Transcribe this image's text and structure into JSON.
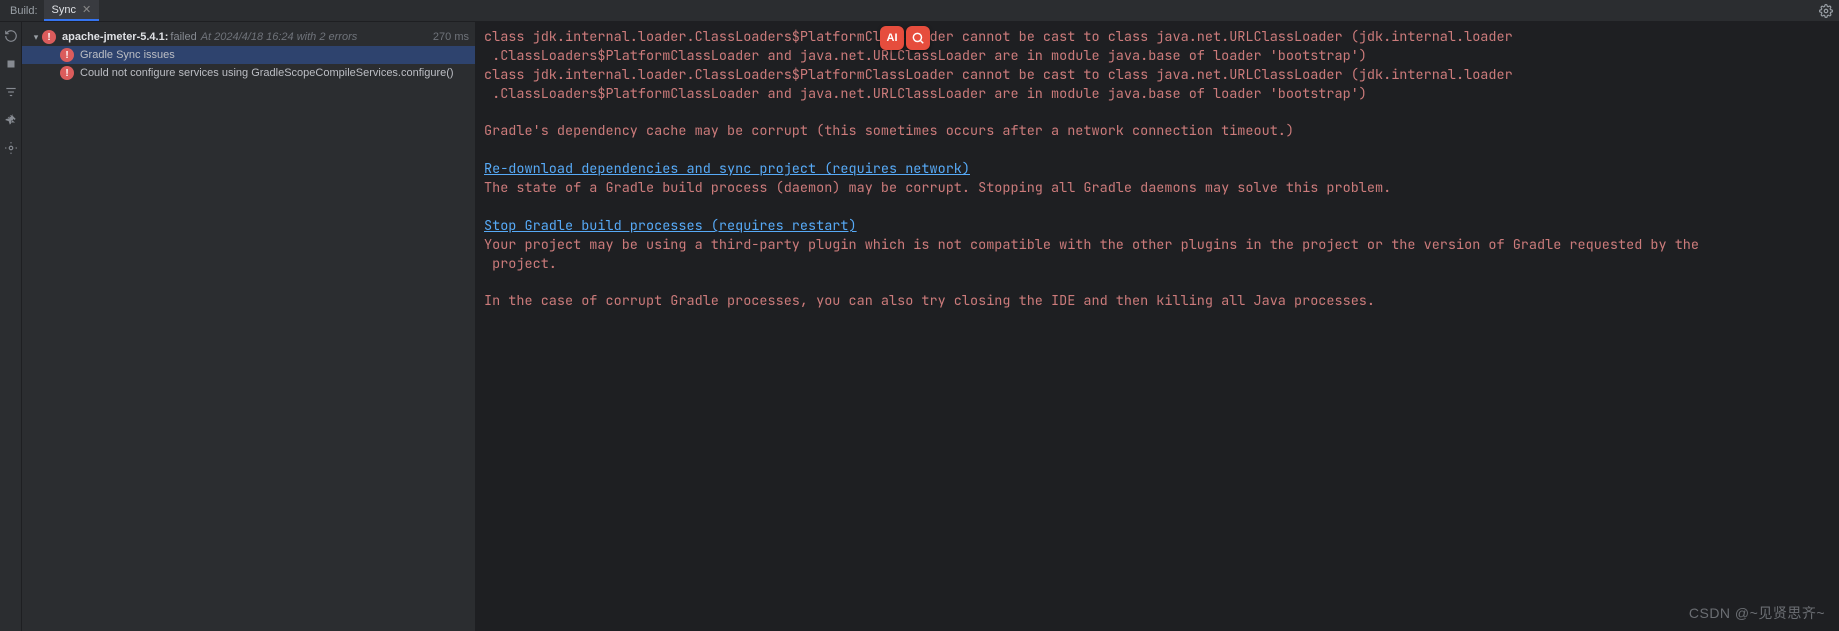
{
  "tabs": {
    "prefix": "Build:",
    "active": "Sync"
  },
  "tree": {
    "root": {
      "name": "apache-jmeter-5.4.1:",
      "status": "failed",
      "timestamp": "At 2024/4/18 16:24 with 2 errors",
      "duration": "270 ms"
    },
    "issues": [
      "Gradle Sync issues",
      "Could not configure services using GradleScopeCompileServices.configure()"
    ]
  },
  "console": {
    "err1a": "class jdk.internal.loader.ClassLoaders$PlatformClassLoader cannot be cast to class java.net.URLClassLoader (jdk.internal.loader",
    "err1b": " .ClassLoaders$PlatformClassLoader and java.net.URLClassLoader are in module java.base of loader 'bootstrap')",
    "err2a": "class jdk.internal.loader.ClassLoaders$PlatformClassLoader cannot be cast to class java.net.URLClassLoader (jdk.internal.loader",
    "err2b": " .ClassLoaders$PlatformClassLoader and java.net.URLClassLoader are in module java.base of loader 'bootstrap')",
    "cache_msg": "Gradle's dependency cache may be corrupt (this sometimes occurs after a network connection timeout.)",
    "link1": "Re-download dependencies and sync project (requires network)",
    "daemon_msg": "The state of a Gradle build process (daemon) may be corrupt. Stopping all Gradle daemons may solve this problem.",
    "link2": "Stop Gradle build processes (requires restart)",
    "plugin_msg": "Your project may be using a third-party plugin which is not compatible with the other plugins in the project or the version of Gradle requested by the\n project.",
    "close_msg": "In the case of corrupt Gradle processes, you can also try closing the IDE and then killing all Java processes."
  },
  "overlay": {
    "badge1": "AI",
    "badge2_icon": "search"
  },
  "watermark": "CSDN @~见贤思齐~"
}
